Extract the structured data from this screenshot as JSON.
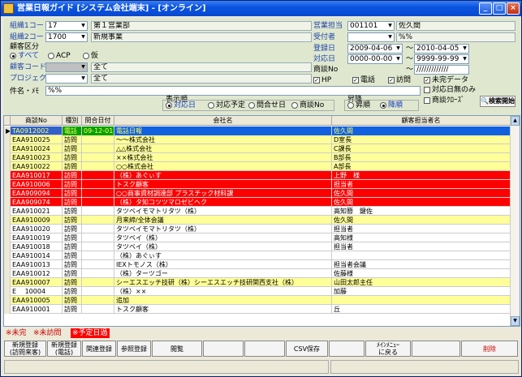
{
  "window": {
    "title": "営業日報ガイド [システム会社端末] - [オンライン]"
  },
  "form": {
    "kumi1_label": "組織1コード",
    "kumi1_code": "17",
    "kumi1_name": "第１営業部",
    "kumi2_label": "組織2コード",
    "kumi2_code": "1700",
    "kumi2_name": "新規事業",
    "kokyaku_kubun_label": "顧客区分",
    "kubun_opts": [
      "すべて",
      "ACP",
      "仮"
    ],
    "kokyaku_label": "顧客コード",
    "kokyaku_name": "全て",
    "project_label": "プロジェクト",
    "project_name": "全て",
    "eigyo_label": "営業担当",
    "eigyo_code": "001101",
    "eigyo_name": "佐久間",
    "uketsuke_label": "受付者",
    "uketsuke_val": "%%",
    "toroku_label": "登録日",
    "toroku_from": "2009-04-06",
    "toroku_to": "2010-04-05",
    "taio_label": "対応日",
    "taio_from": "0000-00-00",
    "taio_to": "9999-99-99",
    "shodan_label": "商談No",
    "shodan_val": "/////////////",
    "tilde": "～",
    "chk_hp": "HP",
    "chk_tel": "電話",
    "chk_visit": "訪問",
    "kenmei_label": "件名・ﾒﾓ",
    "kenmei_val": "%%",
    "hyoji_label": "表示順",
    "hyoji_opts": [
      "対応日",
      "対応予定",
      "問合せ日",
      "商談No"
    ],
    "order_label": "昇降",
    "order_opts": [
      "昇順",
      "降順"
    ],
    "opt_mikan": "未完データ",
    "opt_taio": "対応日無のみ",
    "opt_close": "商談ｸﾛｰｽﾞ",
    "search_btn": "検索開始"
  },
  "table": {
    "headers": [
      "商談No",
      "種別",
      "問合日付",
      "会社名",
      "顧客担当者名"
    ],
    "rows": [
      {
        "no": "TA0912002",
        "kind": "電話",
        "date": "09-12-01",
        "company": "電話日報",
        "person": "佐久間",
        "style": "sel"
      },
      {
        "no": "EAA910025",
        "kind": "訪問",
        "date": "",
        "company": "～～株式会社",
        "person": "D室長",
        "style": "yellow"
      },
      {
        "no": "EAA910024",
        "kind": "訪問",
        "date": "",
        "company": "△△株式会社",
        "person": "C課長",
        "style": "yellow"
      },
      {
        "no": "EAA910023",
        "kind": "訪問",
        "date": "",
        "company": "××株式会社",
        "person": "B部長",
        "style": "yellow"
      },
      {
        "no": "EAA910022",
        "kind": "訪問",
        "date": "",
        "company": "○○株式会社",
        "person": "A部長",
        "style": "yellow"
      },
      {
        "no": "EAA910017",
        "kind": "訪問",
        "date": "",
        "company": "（株）あぐぃす",
        "person": "上野　様",
        "style": "red"
      },
      {
        "no": "EAA910006",
        "kind": "訪問",
        "date": "",
        "company": "トスク顧客",
        "person": "担当者",
        "style": "red"
      },
      {
        "no": "EAA909094",
        "kind": "訪問",
        "date": "",
        "company": "○○商事資材調達部 プラスチック材料課",
        "person": "佐久間",
        "style": "red"
      },
      {
        "no": "EAA909074",
        "kind": "訪問",
        "date": "",
        "company": "（株）タ知コツツマロゼビヘク",
        "person": "佐久間",
        "style": "red"
      },
      {
        "no": "EAA910021",
        "kind": "訪問",
        "date": "",
        "company": "タツベイモマトリタツ（株）",
        "person": "高知簪　鍵佐",
        "style": "white"
      },
      {
        "no": "EAA910009",
        "kind": "訪問",
        "date": "",
        "company": "月来締/全体会議",
        "person": "佐久間",
        "style": "yellow"
      },
      {
        "no": "EAA910020",
        "kind": "訪問",
        "date": "",
        "company": "タツベイモマトリタツ（株）",
        "person": "担当者",
        "style": "white"
      },
      {
        "no": "EAA910019",
        "kind": "訪問",
        "date": "",
        "company": "タツベイ（株）",
        "person": "高知様",
        "style": "white"
      },
      {
        "no": "EAA910018",
        "kind": "訪問",
        "date": "",
        "company": "タツベイ（株）",
        "person": "担当者",
        "style": "white"
      },
      {
        "no": "EAA910014",
        "kind": "訪問",
        "date": "",
        "company": "（株）あぐぃす",
        "person": "",
        "style": "white"
      },
      {
        "no": "EAA910013",
        "kind": "訪問",
        "date": "",
        "company": "IEXトモノス（株）",
        "person": "担当者会議",
        "style": "white"
      },
      {
        "no": "EAA910012",
        "kind": "訪問",
        "date": "",
        "company": "（株）ターツゴー",
        "person": "佐藤様",
        "style": "white"
      },
      {
        "no": "EAA910007",
        "kind": "訪問",
        "date": "",
        "company": "シーエスエッチ技研（株）シーエスエッチ技研関西支社（株）",
        "person": "山田太郎主任",
        "style": "yellow"
      },
      {
        "no": "E　 10004",
        "kind": "訪問",
        "date": "",
        "company": "（株）××",
        "person": "加藤",
        "style": "white"
      },
      {
        "no": "EAA910005",
        "kind": "訪問",
        "date": "",
        "company": "追加",
        "person": "",
        "style": "yellow"
      },
      {
        "no": "EAA910001",
        "kind": "訪問",
        "date": "",
        "company": "トスク顧客",
        "person": "丘",
        "style": "white"
      }
    ]
  },
  "legend": {
    "mikan": "※未完",
    "mihoumon": "※未訪問",
    "yotei": "※予定日過"
  },
  "buttons": {
    "new_visit": "新規登録\n(訪問来客)",
    "new_tel": "新規登録\n(電話)",
    "related": "関連登録",
    "ref": "参照登録",
    "view": "閲覧",
    "csv": "CSV保存",
    "menu": "ﾒｲﾝﾒﾆｭｰ\nに戻る",
    "delete": "削除"
  },
  "colors": {
    "yellow": "#ffff99",
    "red": "#ff0000",
    "sel": "#3060c8",
    "panel": "#dfe8cf"
  }
}
